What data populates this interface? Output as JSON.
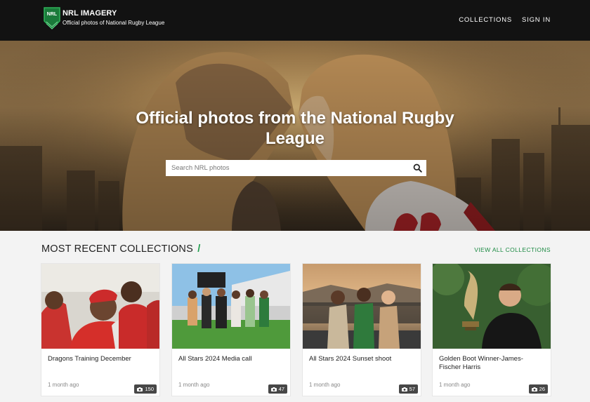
{
  "brand": {
    "logo_text": "NRL",
    "title": "NRL IMAGERY",
    "subtitle": "Official photos of National Rugby League"
  },
  "nav": {
    "collections": "COLLECTIONS",
    "sign_in": "SIGN IN"
  },
  "hero": {
    "title": "Official photos from the National Rugby League",
    "search_placeholder": "Search NRL photos"
  },
  "section": {
    "title": "MOST RECENT COLLECTIONS",
    "slash": "/",
    "view_all": "VIEW ALL COLLECTIONS"
  },
  "collections": [
    {
      "title": "Dragons Training December",
      "count": "150",
      "date": "1 month ago"
    },
    {
      "title": "All Stars 2024 Media call",
      "count": "47",
      "date": "1 month ago"
    },
    {
      "title": "All Stars 2024 Sunset shoot",
      "count": "57",
      "date": "1 month ago"
    },
    {
      "title": "Golden Boot Winner-James-Fischer Harris",
      "count": "26",
      "date": "1 month ago"
    }
  ],
  "colors": {
    "header_bg": "#121212",
    "accent_green": "#1f9d4d",
    "page_bg": "#f3f3f3"
  }
}
